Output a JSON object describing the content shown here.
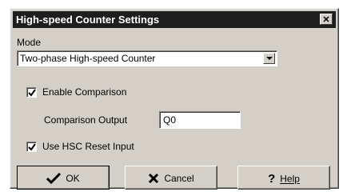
{
  "window": {
    "title": "High-speed Counter Settings",
    "close_glyph": "✕"
  },
  "mode": {
    "label": "Mode",
    "selected": "Two-phase High-speed Counter"
  },
  "comparison": {
    "enable_label": "Enable Comparison",
    "enable_checked": true,
    "output_label": "Comparison Output",
    "output_value": "Q0"
  },
  "reset": {
    "label": "Use HSC Reset Input",
    "checked": true
  },
  "buttons": {
    "ok": {
      "label": "OK",
      "icon": "checkmark-icon"
    },
    "cancel": {
      "label": "Cancel",
      "icon": "x-icon"
    },
    "help": {
      "label": "Help",
      "icon": "question-icon"
    }
  },
  "colors": {
    "titlebar": "#1e1e1e",
    "dialog_face": "#d4d0c8"
  }
}
